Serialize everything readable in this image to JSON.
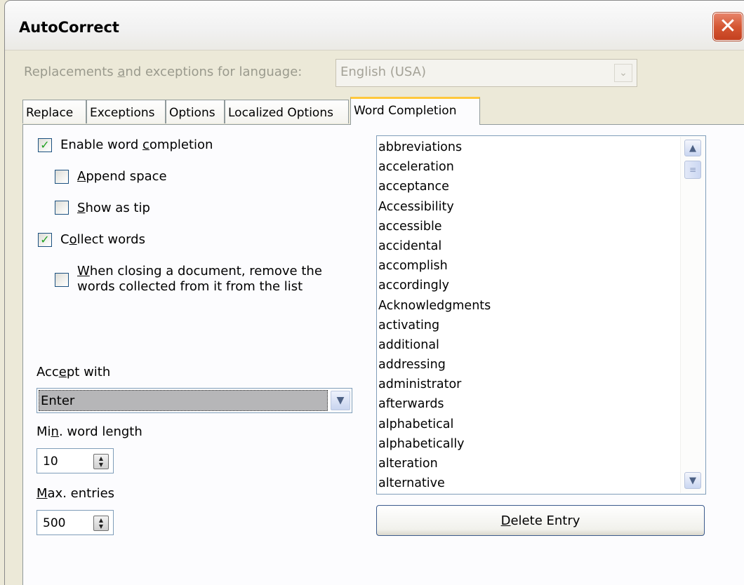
{
  "window": {
    "title": "AutoCorrect",
    "close_symbol": "✕"
  },
  "language": {
    "label_pre": "Replacements ",
    "label_mnemonic": "a",
    "label_post": "nd exceptions for language:",
    "value": "English (USA)"
  },
  "tabs": [
    "Replace",
    "Exceptions",
    "Options",
    "Localized Options",
    "Word Completion"
  ],
  "active_tab": "Word Completion",
  "options": {
    "enable": {
      "pre": "Enable word ",
      "mn": "c",
      "post": "ompletion",
      "checked": true
    },
    "append": {
      "pre": "",
      "mn": "A",
      "post": "ppend space",
      "checked": false
    },
    "tip": {
      "pre": "",
      "mn": "S",
      "post": "how as tip",
      "checked": false
    },
    "collect": {
      "pre": "C",
      "mn": "o",
      "post": "llect words",
      "checked": true
    },
    "remove": {
      "line1_mn": "W",
      "line1_post": "hen closing a document, remove the",
      "line2": "words collected from it from the list",
      "checked": false
    },
    "check_glyph": "✓"
  },
  "accept": {
    "pre": "Acc",
    "mn": "e",
    "post": "pt with",
    "value": "Enter",
    "arrow": "▼"
  },
  "min_length": {
    "pre": "Mi",
    "mn": "n",
    "post": ". word length",
    "value": "10"
  },
  "max_entries": {
    "pre": "",
    "mn": "M",
    "post": "ax. entries",
    "value": "500"
  },
  "spin_up": "▲",
  "spin_down": "▼",
  "word_list": [
    "abbreviations",
    "acceleration",
    "acceptance",
    "Accessibility",
    "accessible",
    "accidental",
    "accomplish",
    "accordingly",
    "Acknowledgments",
    "activating",
    "additional",
    "addressing",
    "administrator",
    "afterwards",
    "alphabetical",
    "alphabetically",
    "alteration",
    "alternative"
  ],
  "scroll": {
    "up": "▲",
    "down": "▼",
    "thumb": "≡"
  },
  "delete_button": {
    "mn": "D",
    "post": "elete Entry"
  },
  "colors": {
    "face": "#ece9d8",
    "tab_highlight": "#ffc83c",
    "check": "#21a121",
    "close": "#d55733"
  }
}
